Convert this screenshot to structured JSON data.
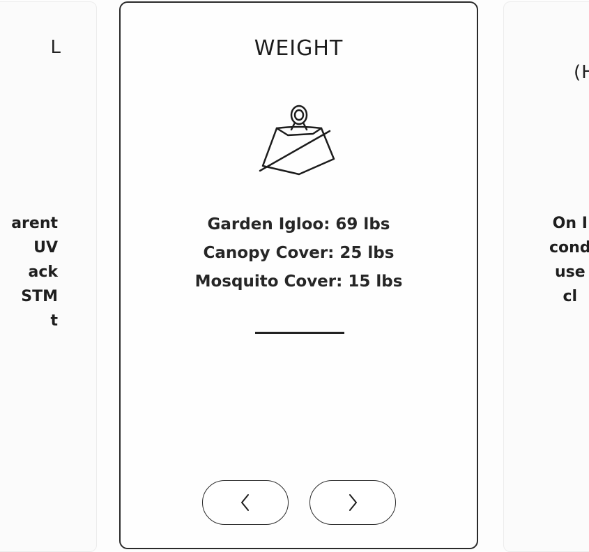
{
  "left_card": {
    "title": "L",
    "lines": [
      "arent",
      "UV",
      "ack",
      "STM",
      "t"
    ]
  },
  "main_card": {
    "title": "WEIGHT",
    "icon": "weight-icon",
    "lines": [
      "Garden Igloo: 69 lbs",
      "Canopy Cover: 25 lbs",
      "Mosquito Cover: 15 lbs"
    ],
    "prev_icon": "chevron-left-icon",
    "next_icon": "chevron-right-icon"
  },
  "right_card": {
    "title": "(H",
    "lines": [
      "On I",
      "cond",
      "use",
      "cl"
    ]
  },
  "colors": {
    "border": "#2a2a2a",
    "text": "#1f1f1f",
    "background": "#ffffff"
  }
}
